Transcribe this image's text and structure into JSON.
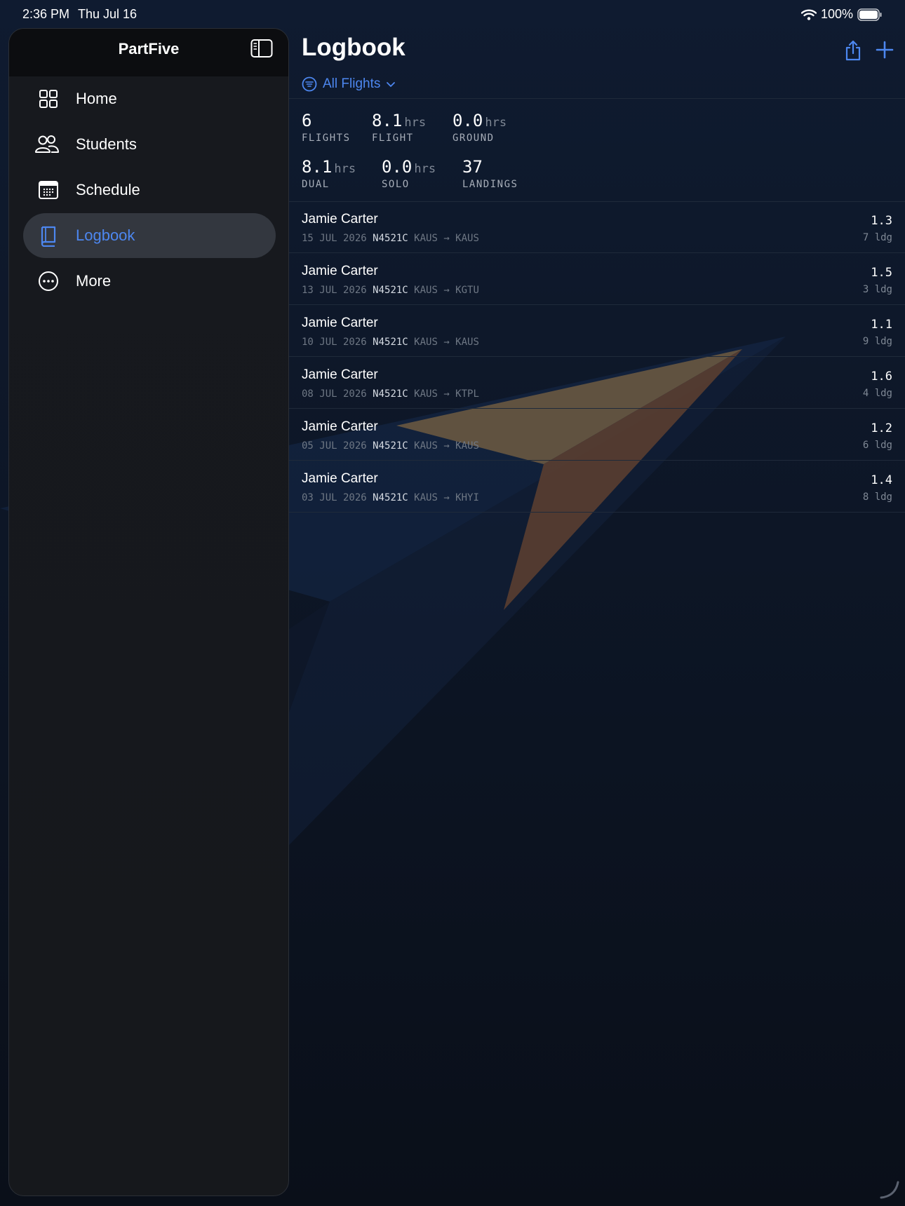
{
  "status_bar": {
    "time": "2:36 PM",
    "date": "Thu Jul 16",
    "battery": "100%"
  },
  "sidebar": {
    "title": "PartFive",
    "items": [
      {
        "label": "Home",
        "icon": "grid-icon",
        "selected": false
      },
      {
        "label": "Students",
        "icon": "people-icon",
        "selected": false
      },
      {
        "label": "Schedule",
        "icon": "calendar-icon",
        "selected": false
      },
      {
        "label": "Logbook",
        "icon": "book-icon",
        "selected": true
      },
      {
        "label": "More",
        "icon": "more-icon",
        "selected": false
      }
    ]
  },
  "main": {
    "title": "Logbook",
    "filter_label": "All Flights",
    "stats": {
      "flights": {
        "value": "6",
        "label": "FLIGHTS"
      },
      "flight": {
        "value": "8.1",
        "unit": "hrs",
        "label": "FLIGHT"
      },
      "ground": {
        "value": "0.0",
        "unit": "hrs",
        "label": "GROUND"
      },
      "dual": {
        "value": "8.1",
        "unit": "hrs",
        "label": "DUAL"
      },
      "solo": {
        "value": "0.0",
        "unit": "hrs",
        "label": "SOLO"
      },
      "landings": {
        "value": "37",
        "label": "LANDINGS"
      }
    },
    "flights": [
      {
        "pilot": "Jamie Carter",
        "date": "15 JUL 2026",
        "tail": "N4521C",
        "route": "KAUS → KAUS",
        "hours": "1.3",
        "landings": "7 ldg"
      },
      {
        "pilot": "Jamie Carter",
        "date": "13 JUL 2026",
        "tail": "N4521C",
        "route": "KAUS → KGTU",
        "hours": "1.5",
        "landings": "3 ldg"
      },
      {
        "pilot": "Jamie Carter",
        "date": "10 JUL 2026",
        "tail": "N4521C",
        "route": "KAUS → KAUS",
        "hours": "1.1",
        "landings": "9 ldg"
      },
      {
        "pilot": "Jamie Carter",
        "date": "08 JUL 2026",
        "tail": "N4521C",
        "route": "KAUS → KTPL",
        "hours": "1.6",
        "landings": "4 ldg"
      },
      {
        "pilot": "Jamie Carter",
        "date": "05 JUL 2026",
        "tail": "N4521C",
        "route": "KAUS → KAUS",
        "hours": "1.2",
        "landings": "6 ldg"
      },
      {
        "pilot": "Jamie Carter",
        "date": "03 JUL 2026",
        "tail": "N4521C",
        "route": "KAUS → KHYI",
        "hours": "1.4",
        "landings": "8 ldg"
      }
    ]
  },
  "colors": {
    "accent": "#4d87f0",
    "background": "#0d1626",
    "sidebar": "#16181c",
    "selected_item": "#33373f",
    "logo_orange": "#7a5a3a"
  }
}
